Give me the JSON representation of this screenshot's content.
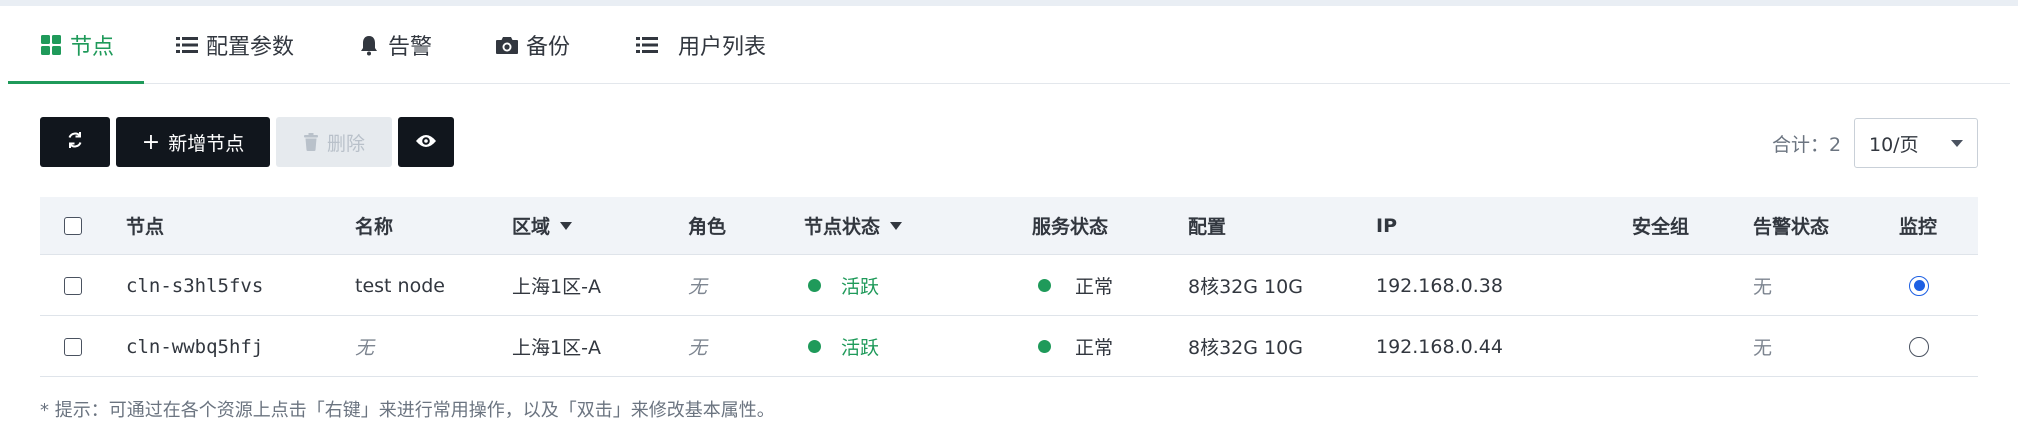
{
  "tabs": [
    {
      "label": "节点",
      "icon": "grid-icon",
      "active": true
    },
    {
      "label": "配置参数",
      "icon": "list-icon",
      "active": false
    },
    {
      "label": "告警",
      "icon": "bell-icon",
      "active": false
    },
    {
      "label": "备份",
      "icon": "camera-icon",
      "active": false
    },
    {
      "label": "用户列表",
      "icon": "list-icon",
      "active": false
    }
  ],
  "toolbar": {
    "refresh_icon": "refresh-icon",
    "add_label": "新增节点",
    "delete_label": "删除",
    "view_icon": "eye-icon"
  },
  "pagination": {
    "total_label": "合计：2",
    "page_size": "10/页"
  },
  "table": {
    "headers": {
      "node": "节点",
      "name": "名称",
      "zone": "区域",
      "role": "角色",
      "node_status": "节点状态",
      "service_status": "服务状态",
      "config": "配置",
      "ip": "IP",
      "security_group": "安全组",
      "alarm_status": "告警状态",
      "monitor": "监控"
    },
    "rows": [
      {
        "node": "cln-s3hl5fvs",
        "name": "test node",
        "zone": "上海1区-A",
        "role": "无",
        "node_status": "活跃",
        "service_status": "正常",
        "config": "8核32G 10G",
        "ip": "192.168.0.38",
        "security_group": "",
        "alarm_status": "无",
        "monitor_selected": true
      },
      {
        "node": "cln-wwbq5hfj",
        "name": "无",
        "zone": "上海1区-A",
        "role": "无",
        "node_status": "活跃",
        "service_status": "正常",
        "config": "8核32G 10G",
        "ip": "192.168.0.44",
        "security_group": "",
        "alarm_status": "无",
        "monitor_selected": false
      }
    ]
  },
  "hint": "* 提示：可通过在各个资源上点击「右键」来进行常用操作，以及「双击」来修改基本属性。",
  "colors": {
    "accent": "#1f9a5a",
    "button_dark": "#11161d",
    "radio_blue": "#1d5fe3"
  }
}
